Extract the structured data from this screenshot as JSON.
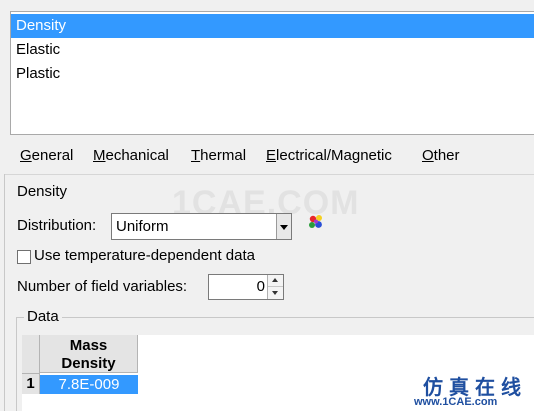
{
  "behaviors": {
    "items": [
      {
        "label": "Density",
        "selected": true
      },
      {
        "label": "Elastic",
        "selected": false
      },
      {
        "label": "Plastic",
        "selected": false
      }
    ]
  },
  "menubar": {
    "items": [
      {
        "mnemonic": "G",
        "rest": "eneral"
      },
      {
        "mnemonic": "M",
        "rest": "echanical"
      },
      {
        "mnemonic": "T",
        "rest": "hermal"
      },
      {
        "mnemonic": "E",
        "rest": "lectrical/Magnetic"
      },
      {
        "mnemonic": "O",
        "rest": "ther"
      }
    ]
  },
  "watermark": "1CAE.COM",
  "density": {
    "section_title": "Density",
    "distribution_label": "Distribution:",
    "distribution_value": "Uniform",
    "temp_dependent_label": "Use temperature-dependent data",
    "temp_dependent_checked": false,
    "field_vars_label": "Number of field variables:",
    "field_vars_value": "0"
  },
  "data": {
    "title": "Data",
    "columns": [
      "Mass\nDensity"
    ],
    "column_lines": [
      "Mass",
      "Density"
    ],
    "rows": [
      {
        "index": "1",
        "cells": [
          "7.8E-009"
        ]
      }
    ]
  },
  "footer_watermark": {
    "cn": "仿真在线",
    "url": "www.1CAE.com"
  },
  "colors": {
    "selection": "#3399ff",
    "panel": "#f0f0f0"
  }
}
